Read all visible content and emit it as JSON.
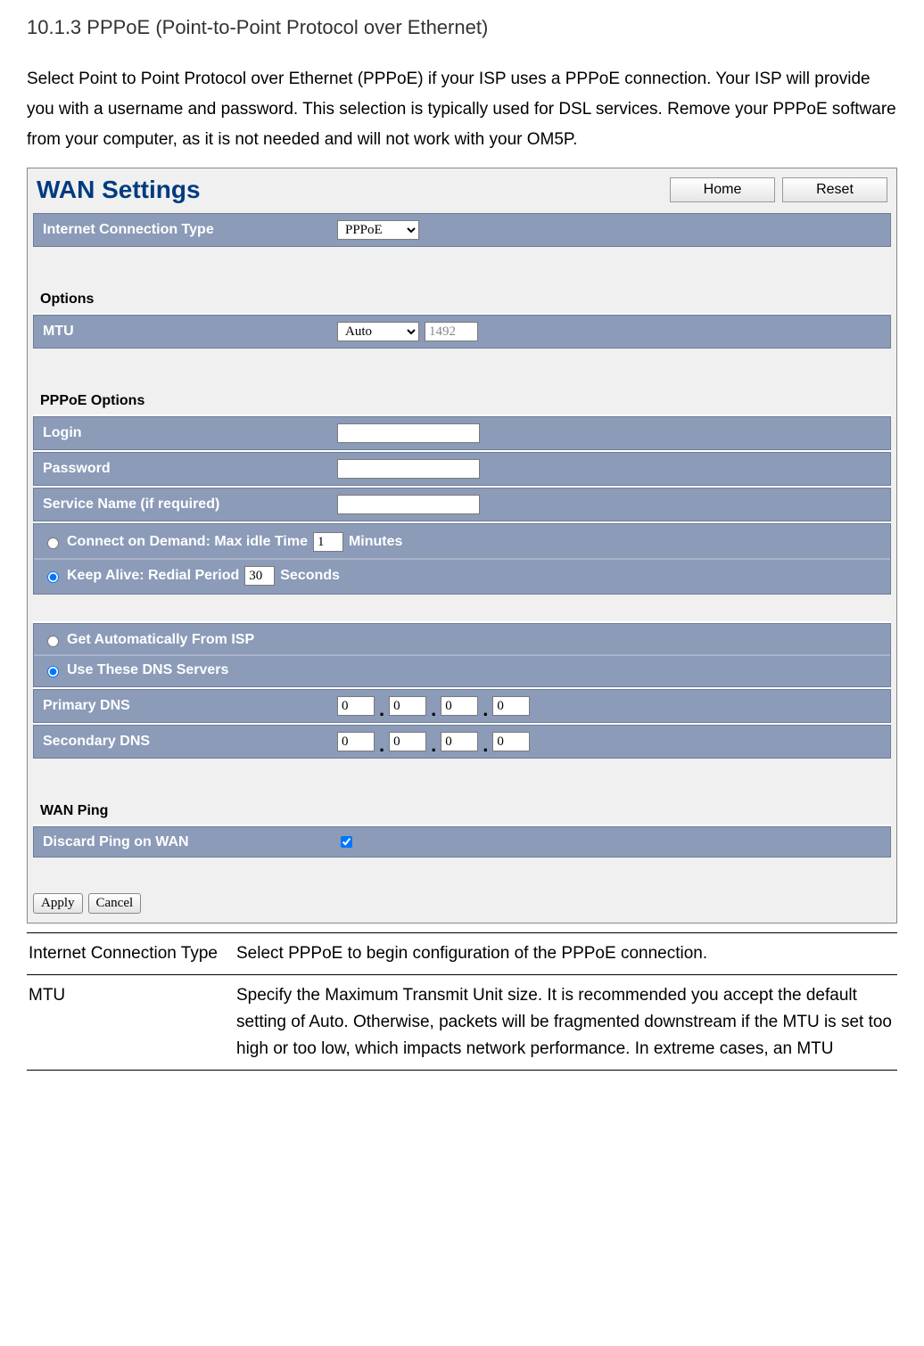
{
  "section_heading": "10.1.3 PPPoE (Point-to-Point Protocol over Ethernet)",
  "intro_text": "Select Point to Point Protocol over Ethernet (PPPoE) if     your ISP uses a PPPoE connection. Your ISP will provide you with a username and password. This selection is typically used for DSL services. Remove  your PPPoE software from your computer, as it is not needed and will not work with your OM5P.",
  "panel": {
    "title": "WAN Settings",
    "home_btn": "Home",
    "reset_btn": "Reset",
    "connection_type": {
      "label": "Internet Connection Type",
      "selected": "PPPoE"
    },
    "options_heading": "Options",
    "mtu": {
      "label": "MTU",
      "mode": "Auto",
      "value": "1492"
    },
    "pppoe_heading": "PPPoE Options",
    "login_label": "Login",
    "password_label": "Password",
    "service_label": "Service Name (if required)",
    "connect_demand": {
      "prefix": "Connect on Demand: Max idle Time",
      "value": "1",
      "suffix": "Minutes"
    },
    "keep_alive": {
      "prefix": "Keep Alive: Redial Period",
      "value": "30",
      "suffix": "Seconds"
    },
    "dns_auto_label": "Get Automatically From ISP",
    "dns_manual_label": "Use These DNS Servers",
    "primary_dns": {
      "label": "Primary DNS",
      "a": "0",
      "b": "0",
      "c": "0",
      "d": "0"
    },
    "secondary_dns": {
      "label": "Secondary DNS",
      "a": "0",
      "b": "0",
      "c": "0",
      "d": "0"
    },
    "wan_ping_heading": "WAN Ping",
    "discard_ping_label": "Discard Ping on WAN",
    "apply_btn": "Apply",
    "cancel_btn": "Cancel"
  },
  "definitions": {
    "row1_term": "Internet Connection Type",
    "row1_def": "Select PPPoE to begin configuration of the PPPoE connection.",
    "row2_term": "MTU",
    "row2_def": "Specify the Maximum Transmit Unit size. It is recommended you accept the default setting of Auto. Otherwise, packets will be fragmented downstream if the MTU is set too high or too low, which impacts network performance. In extreme cases, an MTU"
  }
}
